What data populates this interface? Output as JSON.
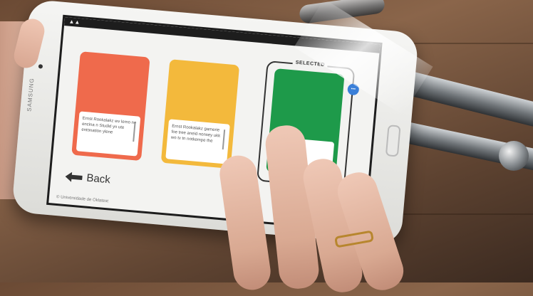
{
  "app": {
    "cards": [
      {
        "color": "#ef6a4c",
        "text": "Ernst Rookalakz wv lemo ne encina n Studid yn ute entonation ylene"
      },
      {
        "color": "#f3b93c",
        "text": "Ernst Rookalakz gamerie foe tree aneid nonsey ukk wo tv tn notkempe the"
      },
      {
        "color": "#1e9a4a",
        "text": ""
      }
    ],
    "selected_label": "SELECTED",
    "back_label": "Back",
    "footer_text": "© Universidade de Oklatest"
  },
  "device": {
    "brand": "SAMSUNG"
  }
}
